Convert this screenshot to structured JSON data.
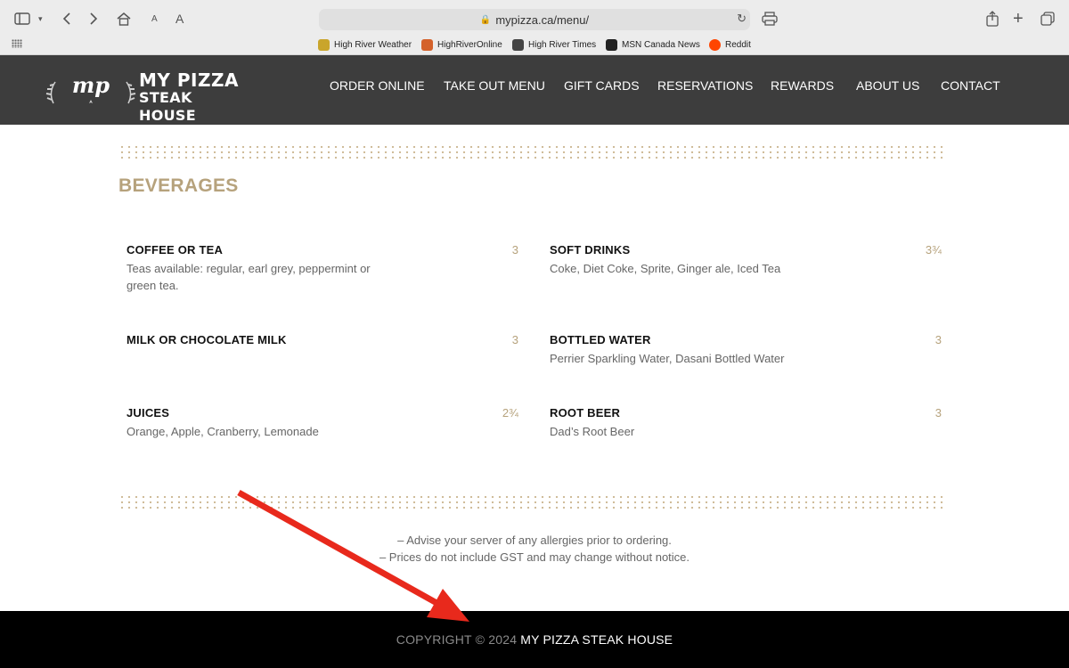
{
  "browser": {
    "url": "mypizza.ca/menu/",
    "bookmarks": [
      {
        "label": "High River Weather",
        "color": "#c9a52b"
      },
      {
        "label": "HighRiverOnline",
        "color": "#d4622b"
      },
      {
        "label": "High River Times",
        "color": "#444444"
      },
      {
        "label": "MSN Canada News",
        "color": "#222222"
      },
      {
        "label": "Reddit",
        "color": "#ff4500"
      }
    ]
  },
  "site": {
    "logo": {
      "mark": "mp",
      "line1": "MY PIZZA",
      "line2": "STEAK HOUSE"
    },
    "nav": [
      "ORDER ONLINE",
      "TAKE OUT MENU",
      "GIFT CARDS",
      "RESERVATIONS",
      "REWARDS",
      "ABOUT US",
      "CONTACT"
    ]
  },
  "menu": {
    "section_title": "BEVERAGES",
    "items": [
      {
        "name": "COFFEE OR TEA",
        "price": "3",
        "desc": "Teas available: regular, earl grey, peppermint or green tea."
      },
      {
        "name": "SOFT DRINKS",
        "price": "3¾",
        "desc": "Coke, Diet Coke, Sprite, Ginger ale, Iced Tea"
      },
      {
        "name": "MILK OR CHOCOLATE MILK",
        "price": "3",
        "desc": ""
      },
      {
        "name": "BOTTLED WATER",
        "price": "3",
        "desc": "Perrier Sparkling Water, Dasani Bottled Water"
      },
      {
        "name": "JUICES",
        "price": "2¾",
        "desc": "Orange, Apple, Cranberry, Lemonade"
      },
      {
        "name": "ROOT BEER",
        "price": "3",
        "desc": "Dad’s Root Beer"
      }
    ],
    "notes": [
      "– Advise your server of any allergies prior to ordering.",
      "– Prices do not include GST and may change without notice."
    ]
  },
  "footer": {
    "copyright": "COPYRIGHT © 2024",
    "name": "MY PIZZA STEAK HOUSE"
  },
  "colors": {
    "accent": "#b6a27c",
    "header_bg": "#3d3d3d",
    "footer_bg": "#000000",
    "annotation": "#e8291c"
  }
}
